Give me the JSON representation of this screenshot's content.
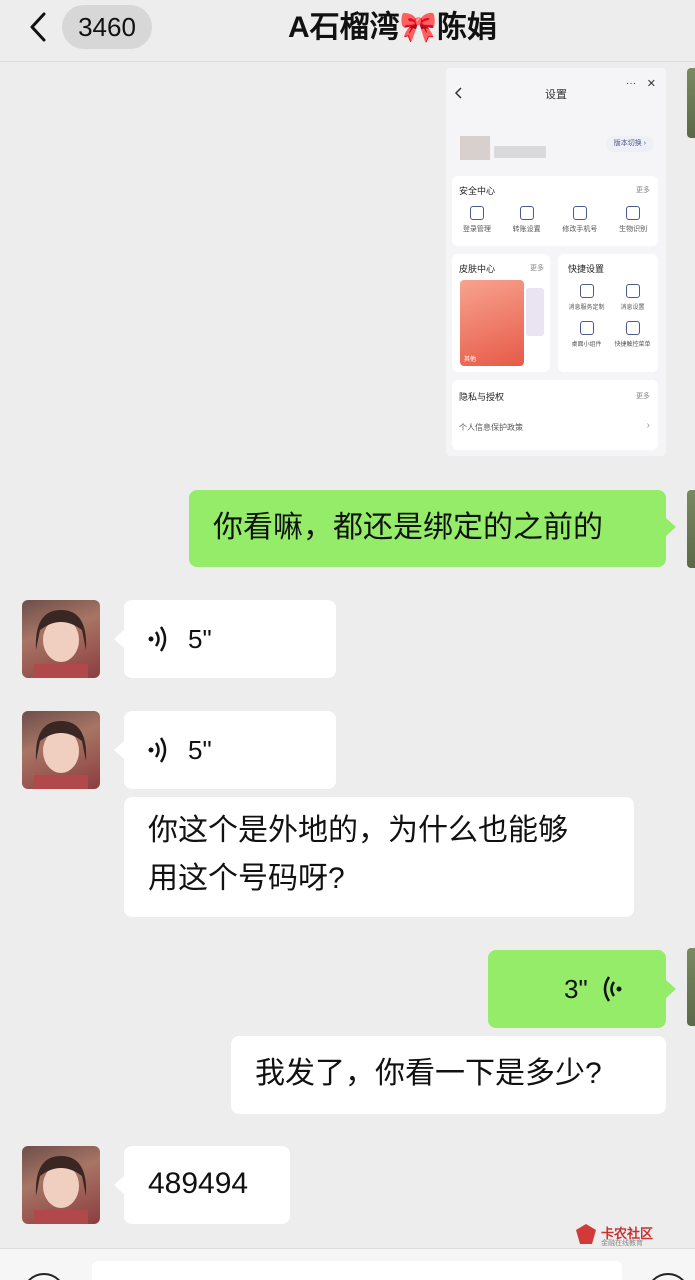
{
  "header": {
    "unread_count": "3460",
    "chat_title": "A石榴湾🎀陈娟"
  },
  "screenshot_image": {
    "title": "设置",
    "version_switch": "版本切换",
    "security": {
      "label": "安全中心",
      "more": "更多",
      "items": [
        "登录管理",
        "转账设置",
        "修改手机号",
        "生物识别"
      ]
    },
    "skin": {
      "label": "皮肤中心",
      "more": "更多",
      "tag": "其他"
    },
    "shortcut": {
      "label": "快捷设置",
      "items": [
        "消息服务定制",
        "消息设置",
        "桌面小组件",
        "快捷触控菜单"
      ]
    },
    "privacy": {
      "label": "隐私与授权",
      "more": "更多",
      "item": "个人信息保护政策"
    }
  },
  "messages": [
    {
      "side": "right",
      "type": "text",
      "text": "你看嘛，都还是绑定的之前的"
    },
    {
      "side": "left",
      "type": "voice",
      "duration": "5\""
    },
    {
      "side": "left",
      "type": "voice",
      "duration": "5\""
    },
    {
      "side": "left",
      "type": "text",
      "line1": "你这个是外地的，为什么也能够",
      "line2": "用这个号码呀?"
    },
    {
      "side": "right",
      "type": "voice",
      "duration": "3\""
    },
    {
      "side": "left",
      "type": "text",
      "text": "我发了，你看一下是多少?"
    },
    {
      "side": "left",
      "type": "text",
      "text": "489494"
    }
  ],
  "watermark": {
    "name": "卡农社区",
    "sub": "金融在线教育"
  }
}
